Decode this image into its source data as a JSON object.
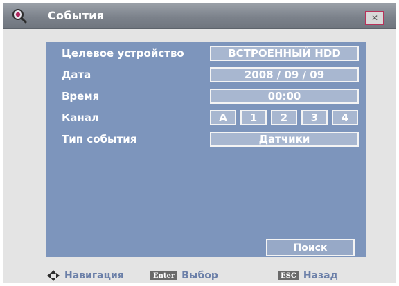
{
  "window": {
    "title": "События",
    "close_symbol": "✕",
    "title_icon": "magnifier-icon"
  },
  "form": {
    "target_device": {
      "label": "Целевое устройство",
      "value": "ВСТРОЕННЫЙ HDD"
    },
    "date": {
      "label": "Дата",
      "value": "2008 / 09 / 09"
    },
    "time": {
      "label": "Время",
      "value": "00:00"
    },
    "channel": {
      "label": "Канал",
      "options": [
        "A",
        "1",
        "2",
        "3",
        "4"
      ]
    },
    "event_type": {
      "label": "Тип события",
      "value": "Датчики"
    }
  },
  "search_button": "Поиск",
  "footer": {
    "navigation": {
      "icon": "navigation-arrows-icon",
      "label": "Навигация"
    },
    "select": {
      "key": "Enter",
      "label": "Выбор"
    },
    "back": {
      "key": "ESC",
      "label": "Назад"
    }
  },
  "colors": {
    "panel": "#7d95bc",
    "titlebar": "#7c828b",
    "close_border": "#b8325a",
    "footer_text": "#6b7fa8"
  }
}
